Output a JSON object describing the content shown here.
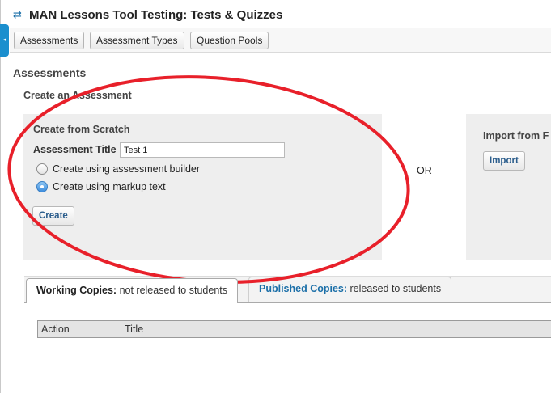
{
  "header": {
    "title": "MAN Lessons Tool Testing: Tests & Quizzes",
    "tool_icon": "refresh-arrows-icon"
  },
  "sidebar_toggle": {
    "icon": "collapse-arrow-icon",
    "glyph": "◂"
  },
  "toolbar": {
    "items": [
      {
        "label": "Assessments"
      },
      {
        "label": "Assessment Types"
      },
      {
        "label": "Question Pools"
      }
    ]
  },
  "main": {
    "heading": "Assessments",
    "create_heading": "Create an Assessment",
    "scratch": {
      "title": "Create from Scratch",
      "field_label": "Assessment Title",
      "field_value": "Test 1",
      "options": [
        {
          "label": "Create using assessment builder",
          "checked": false
        },
        {
          "label": "Create using markup text",
          "checked": true
        }
      ],
      "create_button": "Create"
    },
    "or_label": "OR",
    "import": {
      "title": "Import from F",
      "import_button": "Import"
    }
  },
  "tabs": [
    {
      "lead": "Working Copies:",
      "rest": " not released to students",
      "active": true
    },
    {
      "lead": "Published Copies:",
      "rest": " released to students",
      "active": false
    }
  ],
  "table": {
    "columns": [
      "Action",
      "Title"
    ]
  },
  "colors": {
    "accent": "#1b8fce",
    "annotation_ring": "#e8202a",
    "panel_bg": "#eeeeee"
  }
}
